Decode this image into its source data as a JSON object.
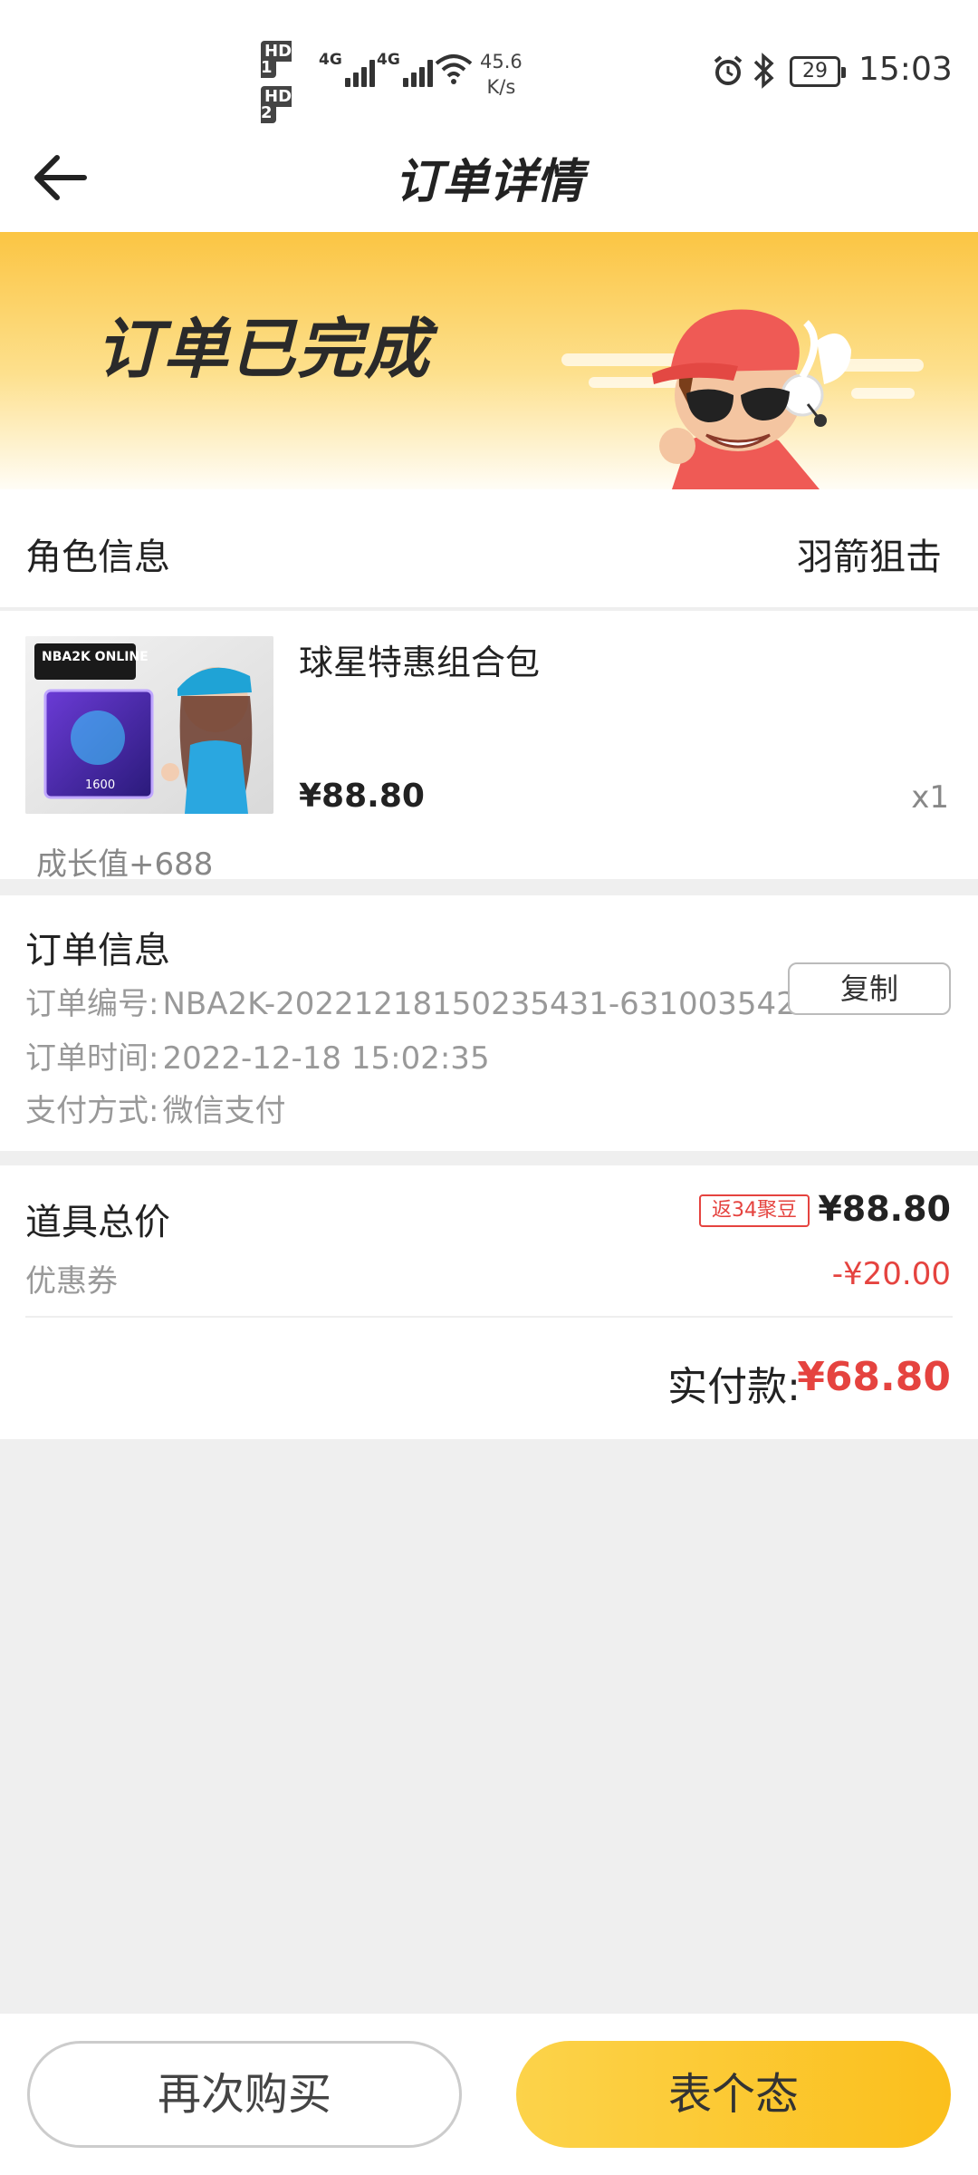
{
  "status_bar": {
    "hd1": "HD 1",
    "hd2": "HD 2",
    "net1": "4G",
    "net2": "4G",
    "speed_value": "45.6",
    "speed_unit": "K/s",
    "battery": "29",
    "time": "15:03"
  },
  "header": {
    "title": "订单详情"
  },
  "banner": {
    "status": "订单已完成"
  },
  "role": {
    "label": "角色信息",
    "value": "羽箭狙击"
  },
  "product": {
    "image_text": "NBA2K ONLINE",
    "image_badge": "1600",
    "name": "球星特惠组合包",
    "price": "¥88.80",
    "quantity": "x1",
    "growth": "成长值+688"
  },
  "order_info": {
    "title": "订单信息",
    "number_label": "订单编号:",
    "number_value": "NBA2K-20221218150235431-631003542",
    "copy_label": "复制",
    "time_label": "订单时间:",
    "time_value": "2022-12-18 15:02:35",
    "payment_label": "支付方式:",
    "payment_value": "微信支付"
  },
  "pricing": {
    "total_label": "道具总价",
    "rebate_badge": "返34聚豆",
    "total_value": "¥88.80",
    "coupon_label": "优惠券",
    "coupon_value": "-¥20.00",
    "paid_label": "实付款:",
    "paid_value": "¥68.80"
  },
  "bottom": {
    "rebuy_label": "再次购买",
    "comment_label": "表个态"
  },
  "colors": {
    "accent_yellow": "#fbc543",
    "price_red": "#e5433f"
  }
}
